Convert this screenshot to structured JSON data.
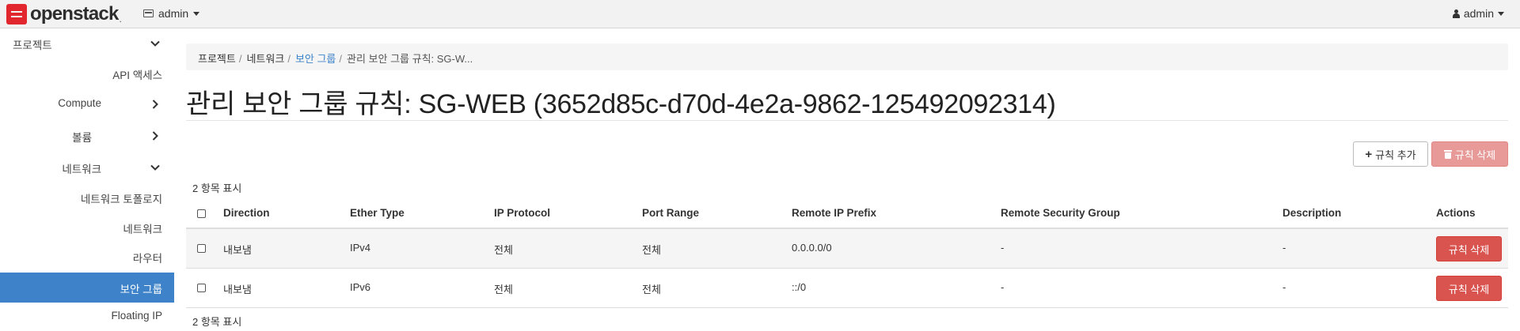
{
  "navbar": {
    "brand": "openstack",
    "brand_dot": ".",
    "project": "admin",
    "user": "admin"
  },
  "sidebar": {
    "items": [
      {
        "label": "프로젝트"
      },
      {
        "label": "API 액세스"
      },
      {
        "label": "Compute"
      },
      {
        "label": "볼륨"
      },
      {
        "label": "네트워크"
      },
      {
        "label": "네트워크 토폴로지"
      },
      {
        "label": "네트워크"
      },
      {
        "label": "라우터"
      },
      {
        "label": "보안 그룹"
      },
      {
        "label": "Floating IP"
      }
    ]
  },
  "breadcrumb": {
    "items": [
      "프로젝트",
      "네트워크",
      "보안 그룹",
      "관리 보안 그룹 규칙: SG-W..."
    ],
    "separator": "/"
  },
  "page": {
    "title": "관리 보안 그룹 규칙: SG-WEB (3652d85c-d70d-4e2a-9862-125492092314)"
  },
  "actions": {
    "add_rule": "규칙 추가",
    "delete_rules": "규칙 삭제"
  },
  "table": {
    "count_top": "2 항목 표시",
    "count_bottom": "2 항목 표시",
    "columns": [
      "Direction",
      "Ether Type",
      "IP Protocol",
      "Port Range",
      "Remote IP Prefix",
      "Remote Security Group",
      "Description",
      "Actions"
    ],
    "rows": [
      {
        "direction": "내보냄",
        "ether_type": "IPv4",
        "ip_protocol": "전체",
        "port_range": "전체",
        "remote_ip_prefix": "0.0.0.0/0",
        "remote_security_group": "-",
        "description": "-",
        "action": "규칙 삭제"
      },
      {
        "direction": "내보냄",
        "ether_type": "IPv6",
        "ip_protocol": "전체",
        "port_range": "전체",
        "remote_ip_prefix": "::/0",
        "remote_security_group": "-",
        "description": "-",
        "action": "규칙 삭제"
      }
    ]
  },
  "colors": {
    "brand_red": "#e1262d",
    "active_blue": "#3e83c9",
    "danger": "#d9534f",
    "danger_disabled": "#e79a98"
  }
}
